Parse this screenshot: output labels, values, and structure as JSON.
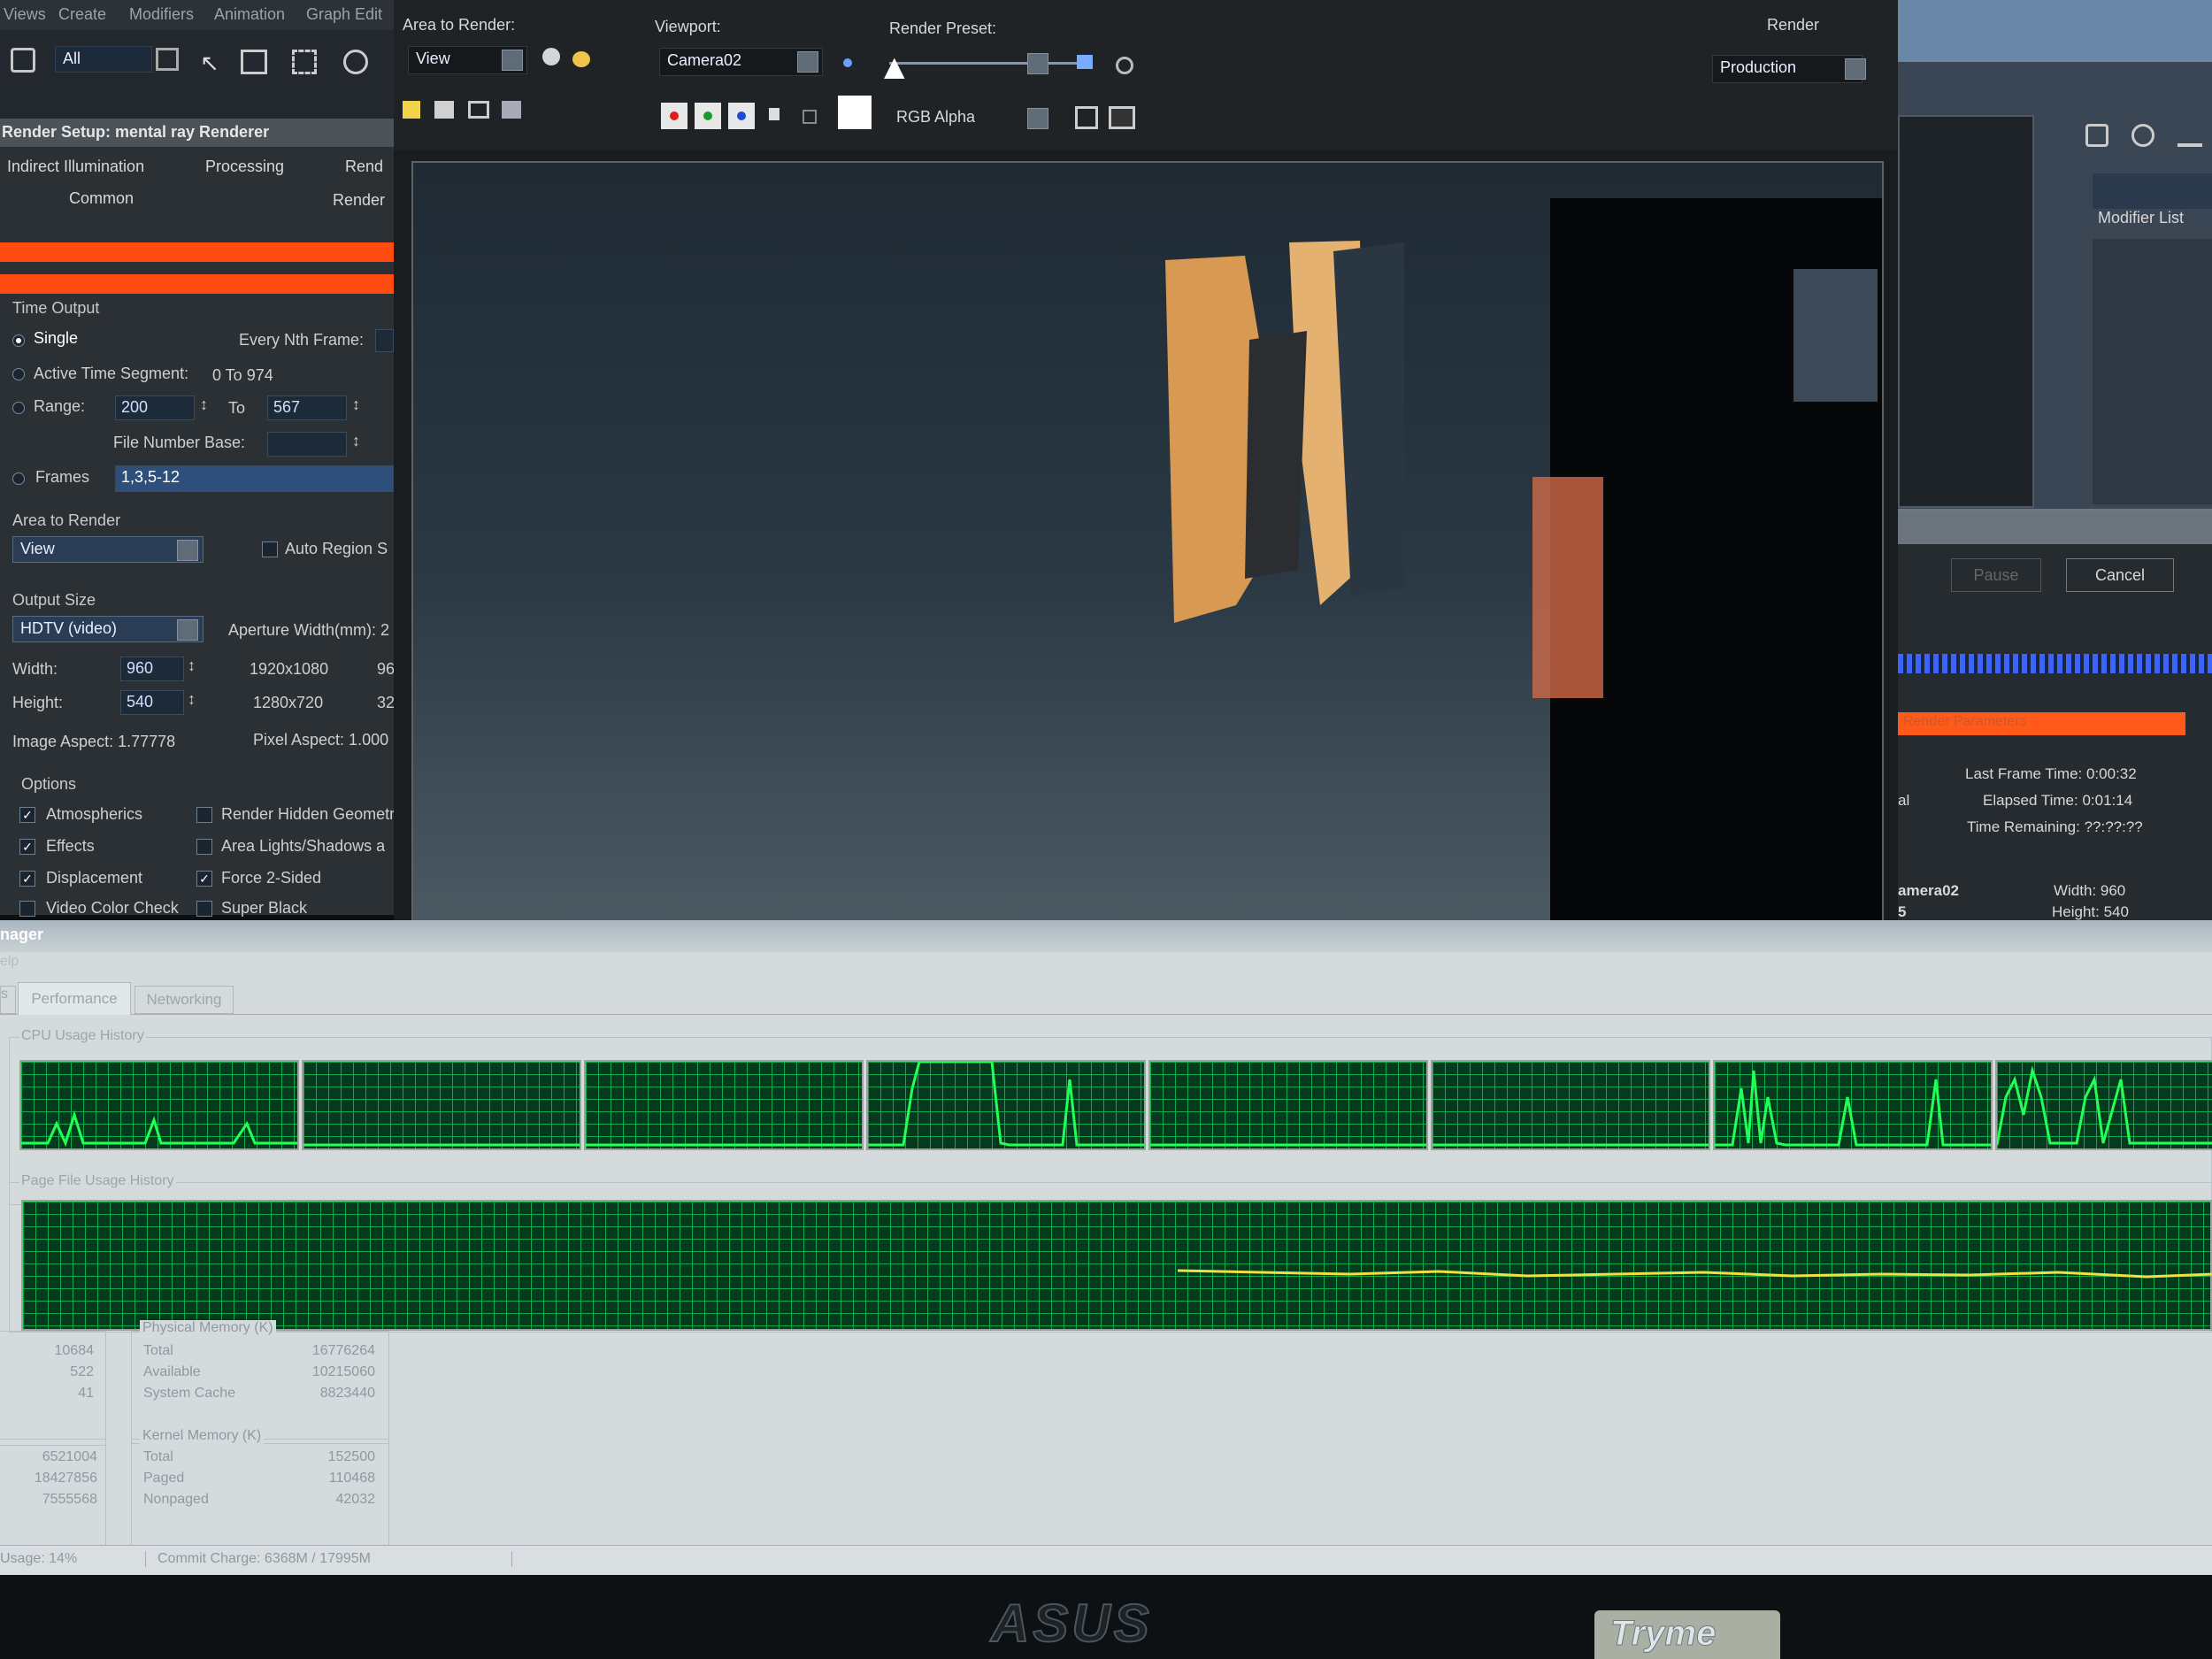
{
  "render_window": {
    "area_to_render_label": "Area to Render:",
    "area_value": "View",
    "viewport_label": "Viewport:",
    "viewport_value": "Camera02",
    "render_preset_label": "Render Preset:",
    "render_label": "Render",
    "render_value": "Production",
    "channel_value": "RGB Alpha"
  },
  "main_menu": [
    "Views",
    "Create",
    "Modifiers",
    "Animation",
    "Graph Edit"
  ],
  "main_toolbar": {
    "selection_filter": "All"
  },
  "render_setup": {
    "title": "Render Setup: mental ray Renderer",
    "tabs": [
      "Indirect Illumination",
      "Processing",
      "Rend",
      "Common",
      "Render"
    ],
    "time_output": {
      "section": "Time Output",
      "single": "Single",
      "every_nth": "Every Nth Frame:",
      "active_segment": "Active Time Segment:",
      "active_segment_value": "0 To 974",
      "range": "Range:",
      "range_from": "200",
      "to": "To",
      "range_to": "567",
      "file_number_base": "File Number Base:",
      "frames": "Frames",
      "frames_value": "1,3,5-12"
    },
    "area_to_render": {
      "section": "Area to Render",
      "value": "View",
      "auto_region": "Auto Region S"
    },
    "output_size": {
      "section": "Output Size",
      "preset": "HDTV (video)",
      "aperture": "Aperture Width(mm): 2",
      "width_label": "Width:",
      "width": "960",
      "height_label": "Height:",
      "height": "540",
      "preset1": "1920x1080",
      "preset1b": "96",
      "preset2": "1280x720",
      "preset2b": "32",
      "image_aspect": "Image Aspect: 1.77778",
      "pixel_aspect": "Pixel Aspect: 1.000"
    },
    "options": {
      "section": "Options",
      "atmospherics": "Atmospherics",
      "effects": "Effects",
      "displacement": "Displacement",
      "video_color": "Video Color Check",
      "render_hidden": "Render Hidden Geometr",
      "area_lights": "Area Lights/Shadows a",
      "force2sided": "Force 2-Sided",
      "super_black": "Super Black"
    }
  },
  "right_panel": {
    "modifier_list": "Modifier List",
    "pause": "Pause",
    "cancel": "Cancel",
    "render_params": "Render Parameters",
    "last_frame_time": "Last Frame Time:  0:00:32",
    "elapsed_time": "Elapsed Time:  0:01:14",
    "time_remaining": "Time Remaining:  ??:??:??",
    "camera": "amera02",
    "frag1": "al",
    "frag2": "5",
    "width": "Width:  960",
    "height": "Height:  540"
  },
  "task_manager": {
    "title": "nager",
    "menu": "elp",
    "tabs": [
      "s",
      "Performance",
      "Networking"
    ],
    "cpu_history": "CPU Usage History",
    "pf_history": "Page File Usage History",
    "totals": [
      "10684",
      "522",
      "41"
    ],
    "commit": [
      "6521004",
      "18427856",
      "7555568"
    ],
    "physical": {
      "title": "Physical Memory (K)",
      "rows": [
        [
          "Total",
          "16776264"
        ],
        [
          "Available",
          "10215060"
        ],
        [
          "System Cache",
          "8823440"
        ]
      ]
    },
    "kernel": {
      "title": "Kernel Memory (K)",
      "rows": [
        [
          "Total",
          "152500"
        ],
        [
          "Paged",
          "110468"
        ],
        [
          "Nonpaged",
          "42032"
        ]
      ]
    },
    "status_cpu": "Usage: 14%",
    "status_commit": "Commit Charge: 6368M / 17995M"
  },
  "bezel": {
    "brand": "ASUS",
    "sticker": "Tryme"
  },
  "colors": {
    "orange": "#ff5a1a",
    "graph_green": "#22ff55",
    "graph_bg": "#063a1e",
    "pf_line": "#f0e040",
    "panel": "#262a2e"
  }
}
